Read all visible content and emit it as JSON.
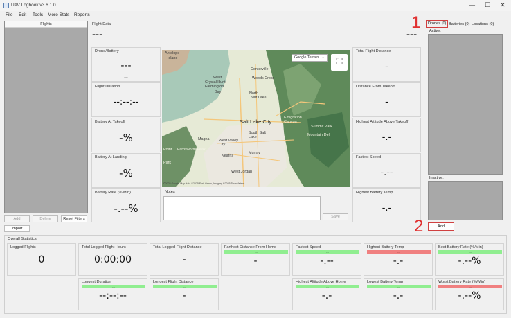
{
  "window": {
    "title": "UAV Logbook v3.6.1.0",
    "min": "—",
    "max": "☐",
    "close": "✕"
  },
  "menu": [
    "File",
    "Edit",
    "Tools",
    "More Stats",
    "Reports"
  ],
  "flights_panel": {
    "header": "Flights",
    "add": "Add",
    "delete": "Delete",
    "reset_filters": "Reset Filters",
    "import": "Import"
  },
  "flight": {
    "data_label": "Flight Data",
    "data_value": "---",
    "drone_label": "Drone/Battery",
    "drone_value": "---",
    "drone_sub": "---",
    "duration_label": "Flight Duration",
    "duration_value": "--:--:--",
    "batt_takeoff_label": "Battery At Takeoff",
    "batt_takeoff_value": "-%",
    "batt_landing_label": "Battery At Landing",
    "batt_landing_value": "-%",
    "batt_rate_label": "Battery Rate (%/Min)",
    "batt_rate_value": "-.--%",
    "total_dist_label": "Total Flight Distance",
    "total_dist_value": "-",
    "dist_takeoff_label": "Distance From Takeoff",
    "dist_takeoff_value": "-",
    "alt_label": "Highest Altitude Above Takeoff",
    "alt_value": "-.-",
    "speed_label": "Fastest Speed",
    "speed_value": "-.--",
    "temp_label": "Highest Battery Temp",
    "temp_value": "-.-",
    "right_value": "---",
    "notes_label": "Notes",
    "save": "Save"
  },
  "map": {
    "select": "Google Terrain",
    "attribution": "©2025 Google Map data ©2025 Esri, Airbus, Imagery ©2025 TerraMetrics",
    "places": [
      {
        "name": "Antelope"
      },
      {
        "name": "Island"
      },
      {
        "name": "West"
      },
      {
        "name": "Crystal Hunt Farmington"
      },
      {
        "name": "Bay"
      },
      {
        "name": "Centerville"
      },
      {
        "name": "North"
      },
      {
        "name": "Salt Lake"
      },
      {
        "name": "Woods Cross"
      },
      {
        "name": "Salt Lake City"
      },
      {
        "name": "Magna"
      },
      {
        "name": "West Valley City"
      },
      {
        "name": "South Salt Lake"
      },
      {
        "name": "Kearns"
      },
      {
        "name": "Murray"
      },
      {
        "name": "West Jordan"
      },
      {
        "name": "Summit Park"
      },
      {
        "name": "Emigration Canyon"
      },
      {
        "name": "Mountain Dell"
      },
      {
        "name": "Farnsworth Peak"
      },
      {
        "name": "Point"
      },
      {
        "name": "Park"
      }
    ]
  },
  "right_panel": {
    "tabs": [
      "Drones (0)",
      "Batteries (0)",
      "Locations (0)"
    ],
    "active_label": "Active:",
    "inactive_label": "Inactive:",
    "add": "Add",
    "annotations": [
      "1",
      "2"
    ]
  },
  "overall": {
    "header": "Overall Statistics",
    "row1": [
      {
        "label": "Logged Flights",
        "value": "0",
        "bar": ""
      },
      {
        "label": "Total Logged Flight Hours",
        "value": "0:00:00",
        "bar": ""
      },
      {
        "label": "Total Logged Flight Distance",
        "value": "-",
        "bar": ""
      },
      {
        "label": "Farthest Distance From Home",
        "value": "-",
        "bar": "green"
      },
      {
        "label": "Fastest Speed",
        "value": "-.--",
        "bar": "green"
      },
      {
        "label": "Highest Battery Temp",
        "value": "-.-",
        "bar": "red"
      },
      {
        "label": "Best Battery Rate (%/Min)",
        "value": "-.--%",
        "bar": "green"
      }
    ],
    "row2": [
      {
        "label": "Longest Duration",
        "value": "--:--:--",
        "bar": "green"
      },
      {
        "label": "Longest Flight Distance",
        "value": "-",
        "bar": "green"
      },
      {
        "label": "Highest Altitude Above Home",
        "value": "-.-",
        "bar": "green"
      },
      {
        "label": "Lowest Battery Temp",
        "value": "-.-",
        "bar": "green"
      },
      {
        "label": "Worst Battery Rate (%/Min)",
        "value": "-.--%",
        "bar": "red"
      }
    ],
    "bar_text": "---"
  },
  "colors": {
    "green_bar": "#90ee90",
    "red_bar": "#f08080",
    "annotation": "#e03030"
  }
}
